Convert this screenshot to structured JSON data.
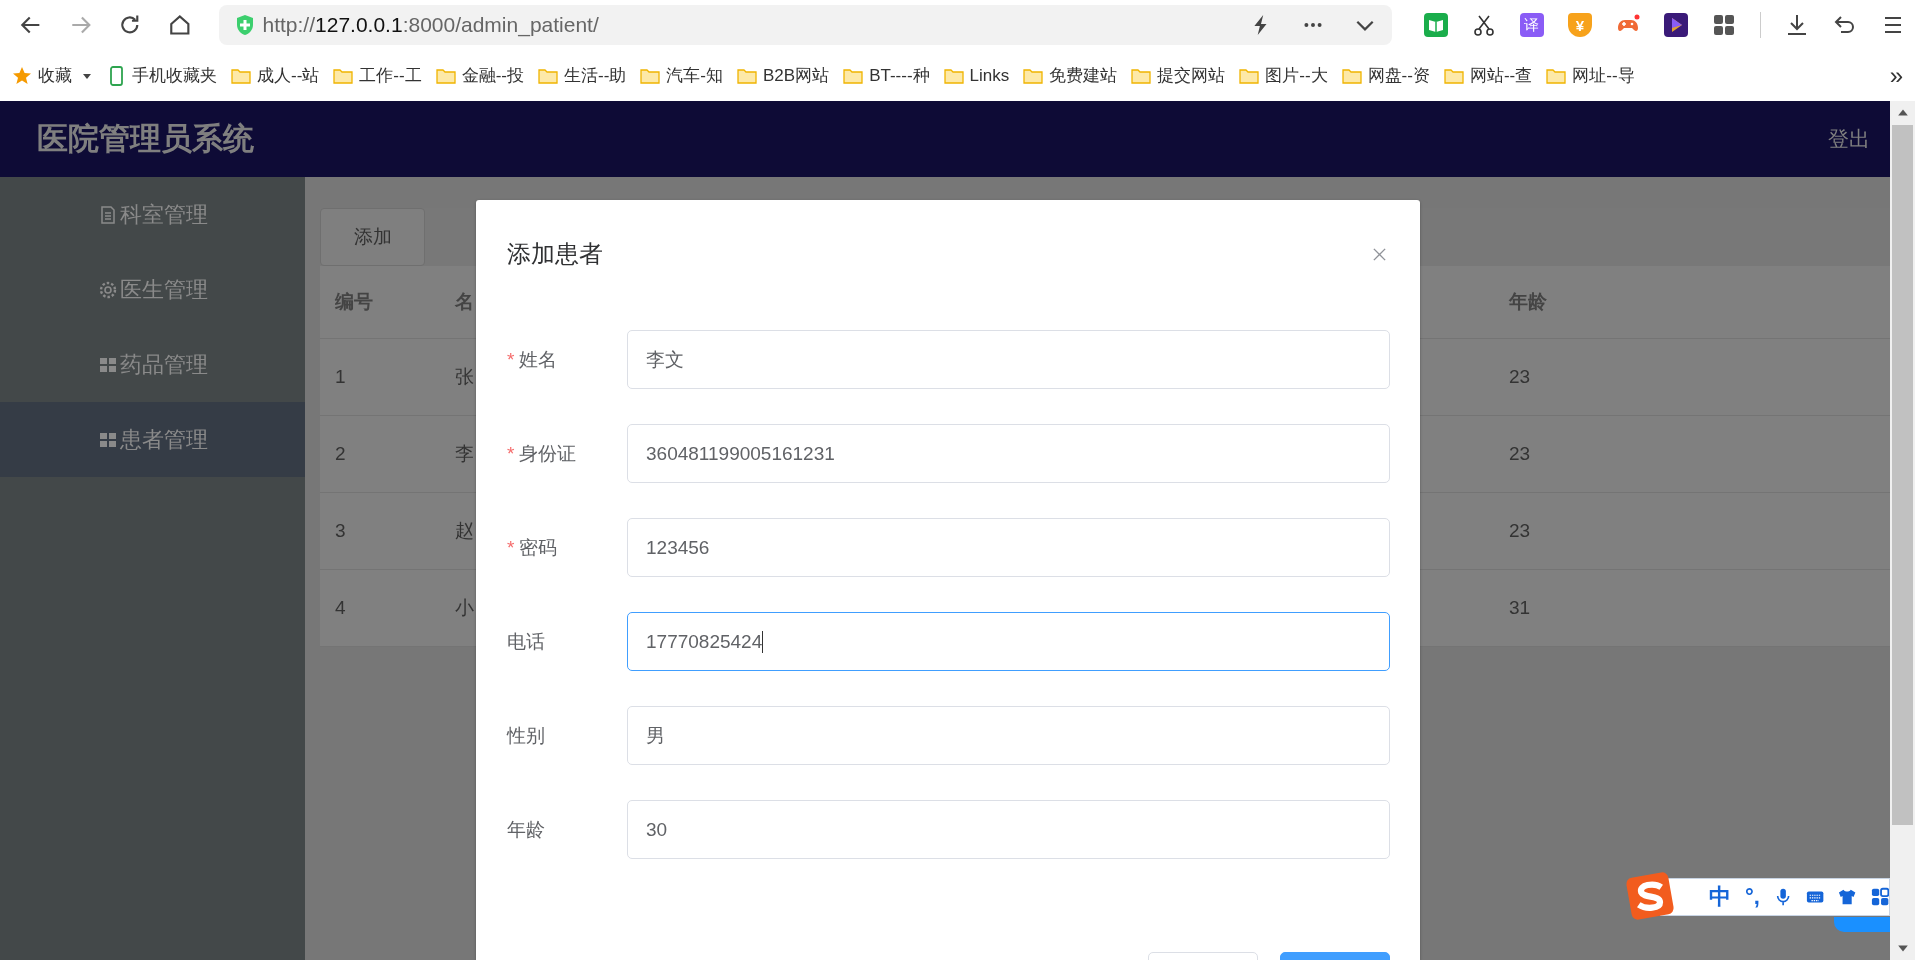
{
  "browser": {
    "address_bar": {
      "url_parts": [
        {
          "text": "http://",
          "emphasis": false
        },
        {
          "text": "127.0.0.1",
          "emphasis": true
        },
        {
          "text": ":8000/admin_patient/",
          "emphasis": false
        }
      ]
    },
    "toolbar_icons": [
      {
        "kind": "book"
      },
      {
        "kind": "scissors"
      },
      {
        "kind": "translate",
        "label": "译"
      },
      {
        "kind": "coupon",
        "label": "¥"
      },
      {
        "kind": "game"
      },
      {
        "kind": "play"
      },
      {
        "kind": "apps"
      },
      {
        "kind": "divider"
      },
      {
        "kind": "download"
      },
      {
        "kind": "undo"
      },
      {
        "kind": "menu"
      }
    ]
  },
  "bookmarks": {
    "favorites": "收藏",
    "mobile": "手机收藏夹",
    "folders": [
      "成人--站",
      "工作--工",
      "金融--投",
      "生活--助",
      "汽车-知",
      "B2B网站",
      "BT----种",
      "Links",
      "免费建站",
      "提交网站",
      "图片--大",
      "网盘--资",
      "网站--查",
      "网址--导"
    ],
    "overflow": "»"
  },
  "app": {
    "title": "医院管理员系统",
    "logout": "登出",
    "sidebar": [
      {
        "label": "科室管理",
        "kind": "document",
        "selected": false
      },
      {
        "label": "医生管理",
        "kind": "gear",
        "selected": false
      },
      {
        "label": "药品管理",
        "kind": "grid",
        "selected": false
      },
      {
        "label": "患者管理",
        "kind": "grid",
        "selected": true
      }
    ],
    "add_button": "添加",
    "table": {
      "columns": [
        "编号",
        "名",
        "年龄"
      ],
      "rows": [
        {
          "id": "1",
          "name": "张",
          "age": "23"
        },
        {
          "id": "2",
          "name": "李",
          "age": "23"
        },
        {
          "id": "3",
          "name": "赵",
          "age": "23"
        },
        {
          "id": "4",
          "name": "小",
          "age": "31"
        }
      ]
    }
  },
  "dialog": {
    "title": "添加患者",
    "fields": [
      {
        "required_mark": "*",
        "label": "姓名",
        "value": "李文",
        "focused": false
      },
      {
        "required_mark": "*",
        "label": "身份证",
        "value": "360481199005161231",
        "focused": false
      },
      {
        "required_mark": "*",
        "label": "密码",
        "value": "123456",
        "focused": false
      },
      {
        "label": "电话",
        "value": "17770825424",
        "focused": true
      },
      {
        "label": "性别",
        "value": "男",
        "focused": false
      },
      {
        "label": "年龄",
        "value": "30",
        "focused": false
      }
    ],
    "footer_buttons": [
      {
        "kind": "default"
      },
      {
        "kind": "primary"
      }
    ]
  },
  "ime": {
    "mode": "中",
    "punctuation": "°,"
  }
}
